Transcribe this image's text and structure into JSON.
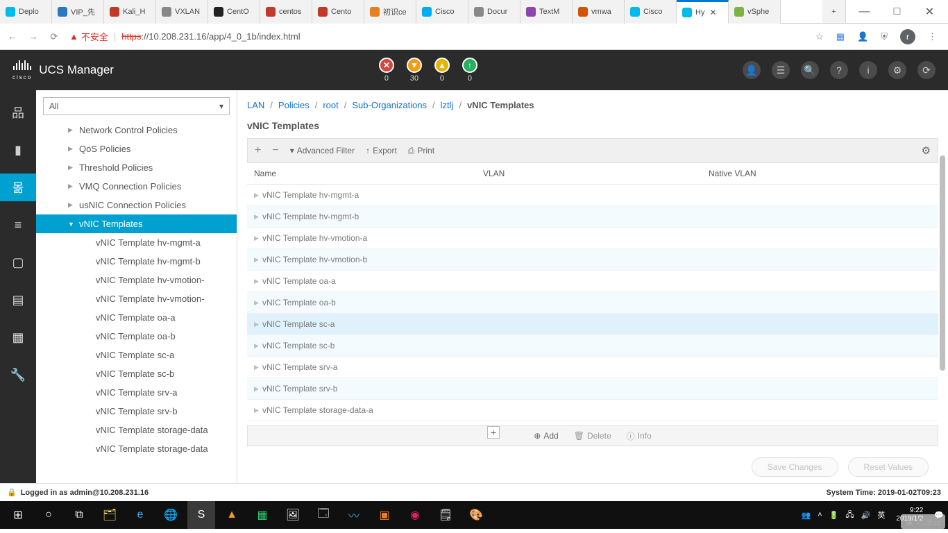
{
  "browser": {
    "tabs": [
      {
        "label": "Deplo",
        "icon": "#00bceb"
      },
      {
        "label": "VIP_先",
        "icon": "#2b77c0"
      },
      {
        "label": "Kali_H",
        "icon": "#c0392b"
      },
      {
        "label": "VXLAN",
        "icon": "#888888"
      },
      {
        "label": "CentO",
        "icon": "#222222"
      },
      {
        "label": "centos",
        "icon": "#c0392b"
      },
      {
        "label": "Cento",
        "icon": "#c0392b"
      },
      {
        "label": "初识ce",
        "icon": "#e67e22"
      },
      {
        "label": "Cisco",
        "icon": "#00aeef"
      },
      {
        "label": "Docur",
        "icon": "#888888"
      },
      {
        "label": "TextM",
        "icon": "#8e44ad"
      },
      {
        "label": "vmwa",
        "icon": "#d35400"
      },
      {
        "label": "Cisco",
        "icon": "#00bceb"
      },
      {
        "label": "Hy",
        "icon": "#00bceb",
        "active": true
      },
      {
        "label": "vSphe",
        "icon": "#7cb342"
      }
    ],
    "new_tab": "+",
    "url_warn": "不安全",
    "url_https": "https",
    "url_rest": "://10.208.231.16/app/4_0_1b/index.html",
    "profile": "r"
  },
  "app": {
    "brand": "cisco",
    "title": "UCS Manager",
    "badges": [
      {
        "color": "#d64541",
        "sym": "✕",
        "num": "0"
      },
      {
        "color": "#f39c12",
        "sym": "▼",
        "num": "30"
      },
      {
        "color": "#e3b505",
        "sym": "▲",
        "num": "0"
      },
      {
        "color": "#27ae60",
        "sym": "↑",
        "num": "0"
      }
    ]
  },
  "filter": "All",
  "tree": {
    "items": [
      {
        "label": "Network Control Policies",
        "lvl": 1
      },
      {
        "label": "QoS Policies",
        "lvl": 1
      },
      {
        "label": "Threshold Policies",
        "lvl": 1
      },
      {
        "label": "VMQ Connection Policies",
        "lvl": 1
      },
      {
        "label": "usNIC Connection Policies",
        "lvl": 1
      },
      {
        "label": "vNIC Templates",
        "lvl": 1,
        "sel": true,
        "open": true
      },
      {
        "label": "vNIC Template hv-mgmt-a",
        "lvl": 2
      },
      {
        "label": "vNIC Template hv-mgmt-b",
        "lvl": 2
      },
      {
        "label": "vNIC Template hv-vmotion-",
        "lvl": 2
      },
      {
        "label": "vNIC Template hv-vmotion-",
        "lvl": 2
      },
      {
        "label": "vNIC Template oa-a",
        "lvl": 2
      },
      {
        "label": "vNIC Template oa-b",
        "lvl": 2
      },
      {
        "label": "vNIC Template sc-a",
        "lvl": 2
      },
      {
        "label": "vNIC Template sc-b",
        "lvl": 2
      },
      {
        "label": "vNIC Template srv-a",
        "lvl": 2
      },
      {
        "label": "vNIC Template srv-b",
        "lvl": 2
      },
      {
        "label": "vNIC Template storage-data",
        "lvl": 2
      },
      {
        "label": "vNIC Template storage-data",
        "lvl": 2
      }
    ]
  },
  "breadcrumb": [
    "LAN",
    "Policies",
    "root",
    "Sub-Organizations",
    "lztlj",
    "vNIC Templates"
  ],
  "section_title": "vNIC Templates",
  "toolbar": {
    "adv": "Advanced Filter",
    "export": "Export",
    "print": "Print"
  },
  "columns": {
    "c1": "Name",
    "c2": "VLAN",
    "c3": "Native VLAN"
  },
  "rows": [
    "vNIC Template hv-mgmt-a",
    "vNIC Template hv-mgmt-b",
    "vNIC Template hv-vmotion-a",
    "vNIC Template hv-vmotion-b",
    "vNIC Template oa-a",
    "vNIC Template oa-b",
    "vNIC Template sc-a",
    "vNIC Template sc-b",
    "vNIC Template srv-a",
    "vNIC Template srv-b",
    "vNIC Template storage-data-a"
  ],
  "row_selected": 6,
  "footer": {
    "add": "Add",
    "delete": "Delete",
    "info": "Info"
  },
  "buttons": {
    "save": "Save Changes",
    "reset": "Reset Values"
  },
  "status": {
    "left": "Logged in as admin@10.208.231.16",
    "right": "System Time: 2019-01-02T09:23"
  },
  "taskbar": {
    "time": "9:22",
    "date": "2019/1/2",
    "ime": "英"
  },
  "watermark": "亿速云"
}
